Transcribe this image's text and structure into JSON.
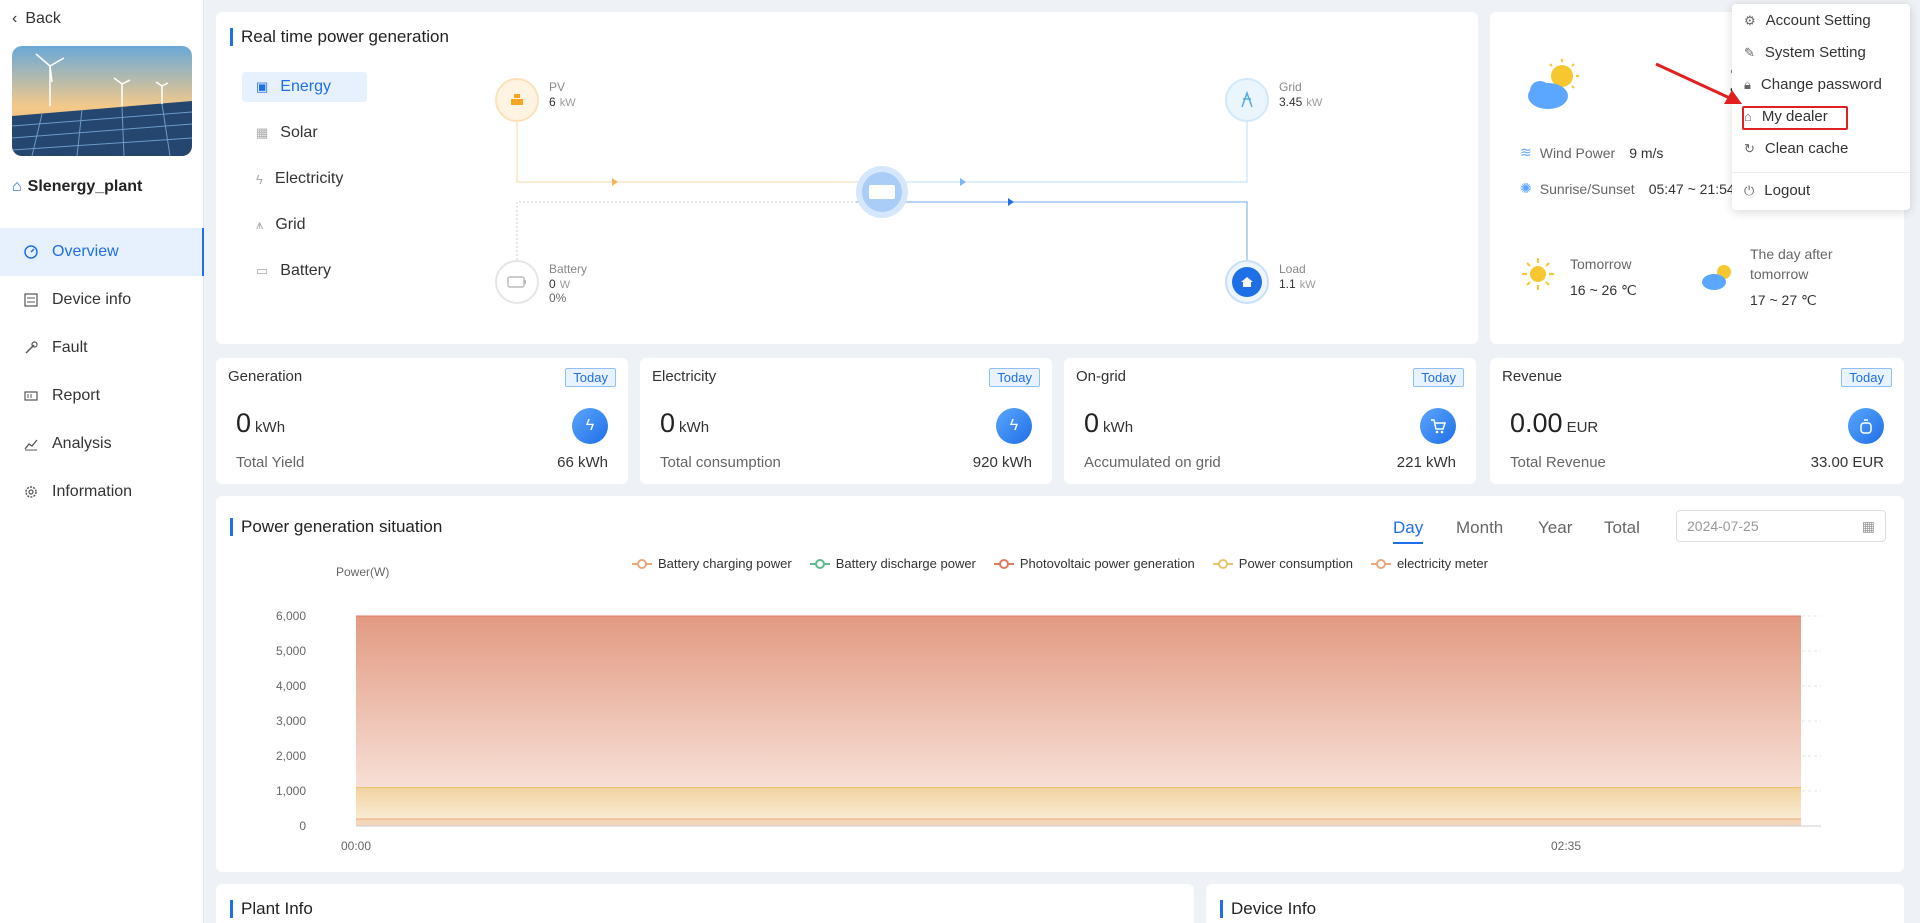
{
  "sidebar": {
    "back_label": "Back",
    "plant_name": "Slenergy_plant",
    "items": [
      {
        "label": "Overview",
        "icon": "dashboard-icon"
      },
      {
        "label": "Device info",
        "icon": "list-icon"
      },
      {
        "label": "Fault",
        "icon": "wrench-icon"
      },
      {
        "label": "Report",
        "icon": "report-icon"
      },
      {
        "label": "Analysis",
        "icon": "chart-icon"
      },
      {
        "label": "Information",
        "icon": "gear-icon"
      }
    ]
  },
  "realtime": {
    "title": "Real time power generation",
    "tabs": [
      "Energy",
      "Solar",
      "Electricity",
      "Grid",
      "Battery"
    ],
    "pv": {
      "label": "PV",
      "value": "6",
      "unit": "kW"
    },
    "grid": {
      "label": "Grid",
      "value": "3.45",
      "unit": "kW"
    },
    "battery": {
      "label": "Battery",
      "value": "0",
      "unit": "W",
      "percent": "0%"
    },
    "load": {
      "label": "Load",
      "value": "1.1",
      "unit": "kW"
    }
  },
  "weather": {
    "temp_partial": "1",
    "wind_label": "Wind Power",
    "wind_value": "9 m/s",
    "sun_label": "Sunrise/Sunset",
    "sun_value": "05:47 ~ 21:54",
    "tomorrow_label": "Tomorrow",
    "tomorrow_temp": "16 ~ 26 ℃",
    "after_label_1": "The day after",
    "after_label_2": "tomorrow",
    "after_temp": "17 ~ 27 ℃"
  },
  "dropdown": {
    "items": [
      "Account Setting",
      "System Setting",
      "Change password",
      "My dealer",
      "Clean cache",
      "Logout"
    ]
  },
  "stats": [
    {
      "label": "Generation",
      "badge": "Today",
      "value": "0",
      "unit": "kWh",
      "sub_label": "Total Yield",
      "sub_value": "66 kWh"
    },
    {
      "label": "Electricity",
      "badge": "Today",
      "value": "0",
      "unit": "kWh",
      "sub_label": "Total consumption",
      "sub_value": "920 kWh"
    },
    {
      "label": "On-grid",
      "badge": "Today",
      "value": "0",
      "unit": "kWh",
      "sub_label": "Accumulated on grid",
      "sub_value": "221 kWh"
    },
    {
      "label": "Revenue",
      "badge": "Today",
      "value": "0.00",
      "unit": "EUR",
      "sub_label": "Total Revenue",
      "sub_value": "33.00 EUR"
    }
  ],
  "situation": {
    "title": "Power generation situation",
    "periods": [
      "Day",
      "Month",
      "Year",
      "Total"
    ],
    "date": "2024-07-25"
  },
  "chart_data": {
    "type": "area",
    "ylabel": "Power(W)",
    "ylim": [
      0,
      6000
    ],
    "yticks": [
      "6,000",
      "5,000",
      "4,000",
      "3,000",
      "2,000",
      "1,000",
      "0"
    ],
    "xticks": [
      "00:00",
      "02:35"
    ],
    "series": [
      {
        "name": "Battery charging power",
        "color": "#e8a87c",
        "values": [
          0,
          0
        ]
      },
      {
        "name": "Battery discharge power",
        "color": "#5fb88f",
        "values": [
          0,
          0
        ]
      },
      {
        "name": "Photovoltaic power generation",
        "color": "#e07a5f",
        "values": [
          6000,
          6000
        ]
      },
      {
        "name": "Power consumption",
        "color": "#e9c46a",
        "values": [
          1100,
          1100
        ]
      },
      {
        "name": "electricity meter",
        "color": "#e8a87c",
        "values": [
          200,
          200
        ]
      }
    ]
  },
  "bottom": {
    "plant_info": "Plant Info",
    "device_info": "Device Info"
  }
}
